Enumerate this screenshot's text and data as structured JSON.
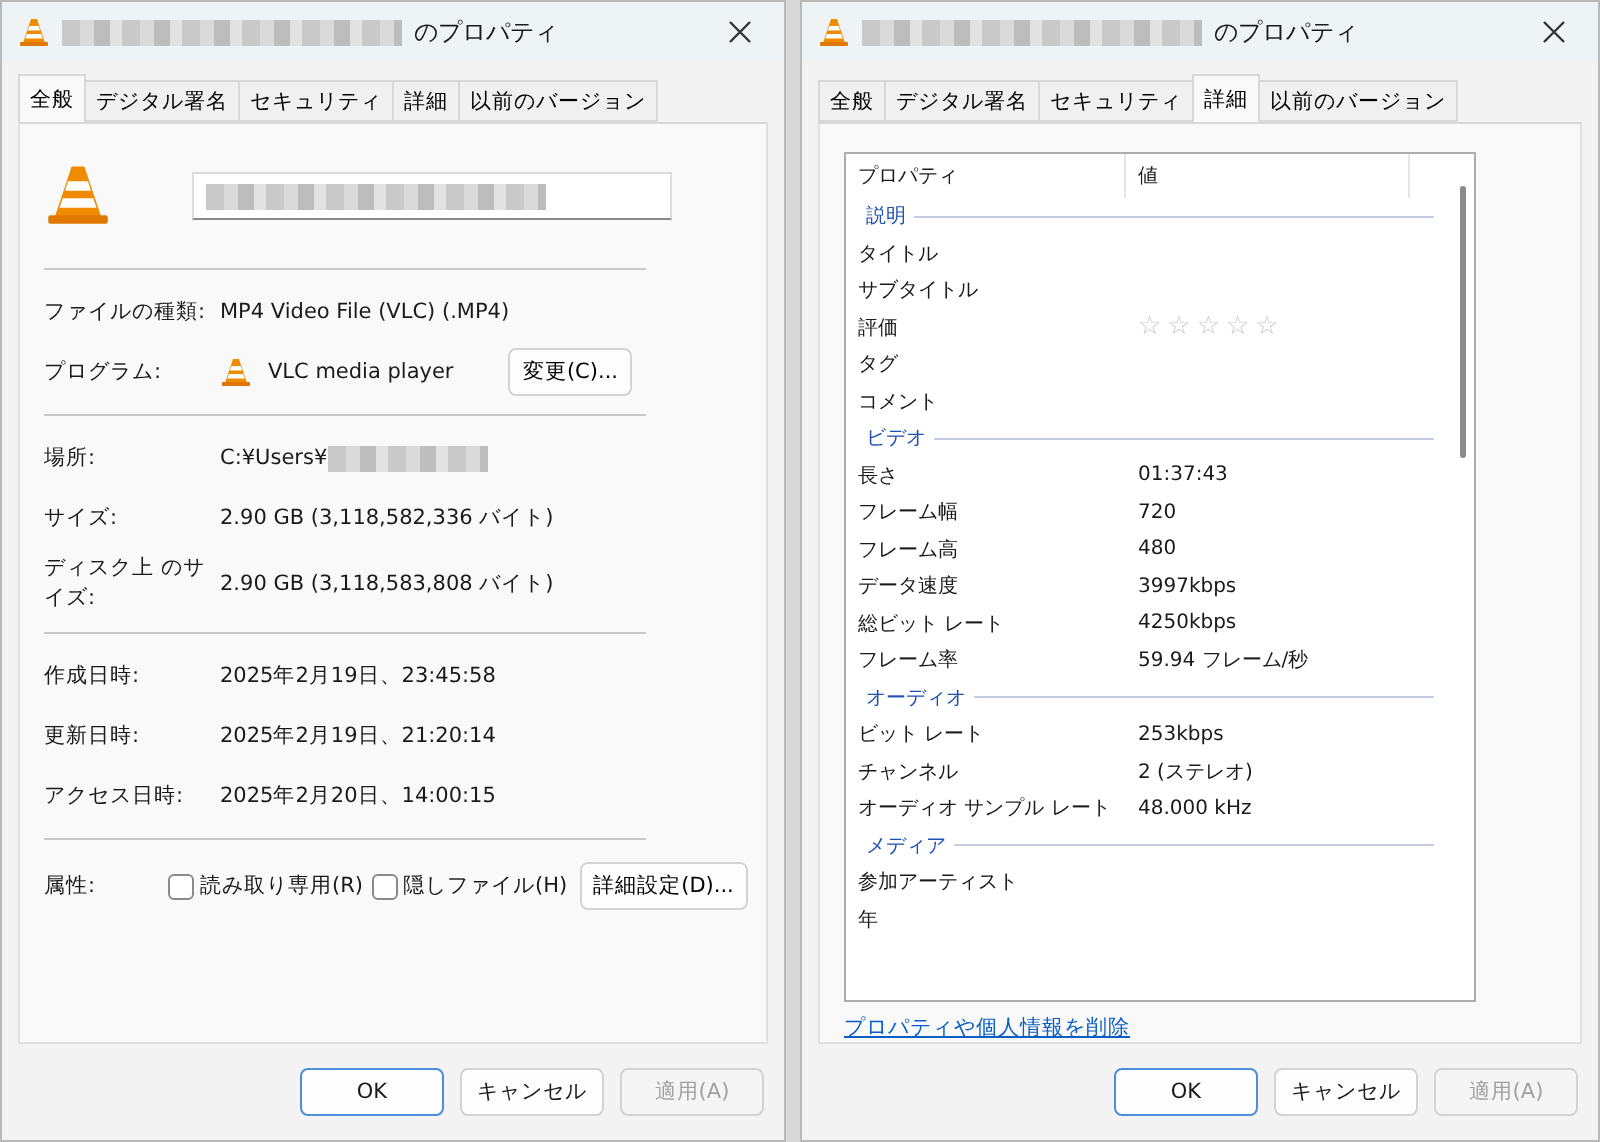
{
  "windows": [
    {
      "kind": "general",
      "title": "のプロパティ",
      "tabs": [
        {
          "label": "全般",
          "selected": true
        },
        {
          "label": "デジタル署名",
          "selected": false
        },
        {
          "label": "セキュリティ",
          "selected": false
        },
        {
          "label": "詳細",
          "selected": false
        },
        {
          "label": "以前のバージョン",
          "selected": false
        }
      ],
      "file_type": {
        "label": "ファイルの種類:",
        "value": "MP4 Video File (VLC) (.MP4)"
      },
      "program": {
        "label": "プログラム:",
        "value": "VLC media player",
        "button": "変更(C)..."
      },
      "location": {
        "label": "場所:",
        "value": "C:¥Users¥"
      },
      "sizes": [
        {
          "label": "サイズ:",
          "value": "2.90 GB (3,118,582,336 バイト)"
        },
        {
          "label": "ディスク上 のサイズ:",
          "value": "2.90 GB (3,118,583,808 バイト)"
        }
      ],
      "dates": [
        {
          "label": "作成日時:",
          "value": "2025年2月19日、23:45:58"
        },
        {
          "label": "更新日時:",
          "value": "2025年2月19日、21:20:14"
        },
        {
          "label": "アクセス日時:",
          "value": "2025年2月20日、14:00:15"
        }
      ],
      "attributes": {
        "label": "属性:",
        "checkboxes": [
          {
            "label": "読み取り専用(R)",
            "checked": false
          },
          {
            "label": "隠しファイル(H)",
            "checked": false
          }
        ],
        "button": "詳細設定(D)..."
      },
      "buttons": [
        {
          "label": "OK",
          "kind": "default",
          "disabled": false
        },
        {
          "label": "キャンセル",
          "kind": "normal",
          "disabled": false
        },
        {
          "label": "適用(A)",
          "kind": "normal",
          "disabled": true
        }
      ]
    },
    {
      "kind": "details",
      "title": "のプロパティ",
      "tabs": [
        {
          "label": "全般",
          "selected": false
        },
        {
          "label": "デジタル署名",
          "selected": false
        },
        {
          "label": "セキュリティ",
          "selected": false
        },
        {
          "label": "詳細",
          "selected": true
        },
        {
          "label": "以前のバージョン",
          "selected": false
        }
      ],
      "columns": [
        "プロパティ",
        "値"
      ],
      "groups": [
        {
          "name": "説明",
          "rows": [
            {
              "property": "タイトル"
            },
            {
              "property": "サブタイトル"
            },
            {
              "property": "評価",
              "stars": 0
            },
            {
              "property": "タグ"
            },
            {
              "property": "コメント"
            }
          ]
        },
        {
          "name": "ビデオ",
          "rows": [
            {
              "property": "長さ",
              "value": "01:37:43"
            },
            {
              "property": "フレーム幅",
              "value": "720"
            },
            {
              "property": "フレーム高",
              "value": "480"
            },
            {
              "property": "データ速度",
              "value": "3997kbps"
            },
            {
              "property": "総ビット レート",
              "value": "4250kbps"
            },
            {
              "property": "フレーム率",
              "value": "59.94 フレーム/秒"
            }
          ]
        },
        {
          "name": "オーディオ",
          "rows": [
            {
              "property": "ビット レート",
              "value": "253kbps"
            },
            {
              "property": "チャンネル",
              "value": "2 (ステレオ)"
            },
            {
              "property": "オーディオ サンプル レート",
              "value": "48.000 kHz"
            }
          ]
        },
        {
          "name": "メディア",
          "rows": [
            {
              "property": "参加アーティスト"
            },
            {
              "property": "年"
            }
          ]
        }
      ],
      "link": "プロパティや個人情報を削除",
      "buttons": [
        {
          "label": "OK",
          "kind": "default",
          "disabled": false
        },
        {
          "label": "キャンセル",
          "kind": "normal",
          "disabled": false
        },
        {
          "label": "適用(A)",
          "kind": "normal",
          "disabled": true
        }
      ]
    }
  ]
}
